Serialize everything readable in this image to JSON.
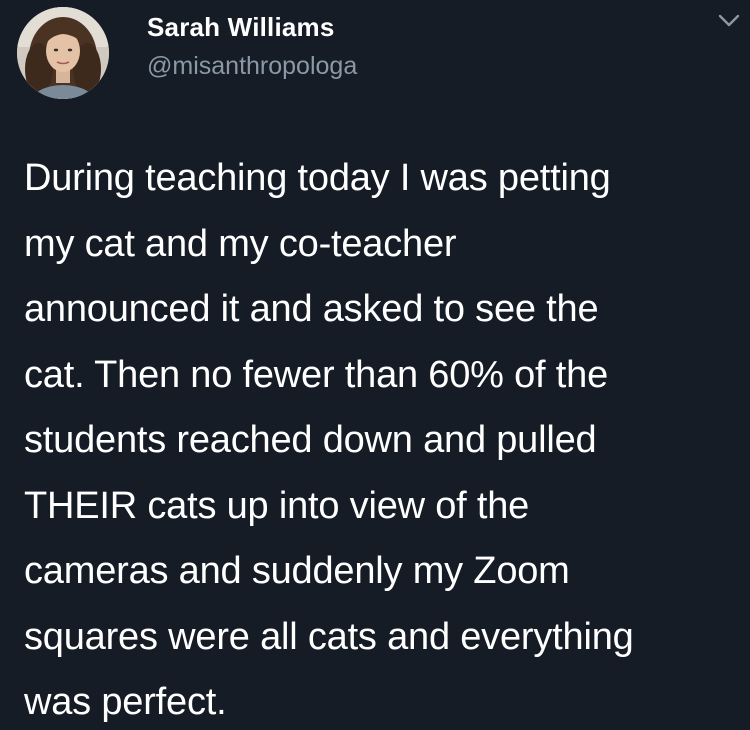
{
  "author": {
    "display_name": "Sarah Williams",
    "handle": "@misanthropologa",
    "avatar_icon": "profile-photo"
  },
  "menu": {
    "icon": "chevron-down-icon"
  },
  "tweet": {
    "text": "During teaching today I was petting\nmy cat and my co-teacher\nannounced it and asked to see the\ncat. Then no fewer than 60% of the\nstudents reached down and pulled\nTHEIR cats up into view of the\ncameras and suddenly my Zoom\nsquares were all cats and everything\nwas perfect."
  },
  "colors": {
    "background": "#151c26",
    "text_primary": "#ffffff",
    "text_secondary": "#8b98a5"
  }
}
